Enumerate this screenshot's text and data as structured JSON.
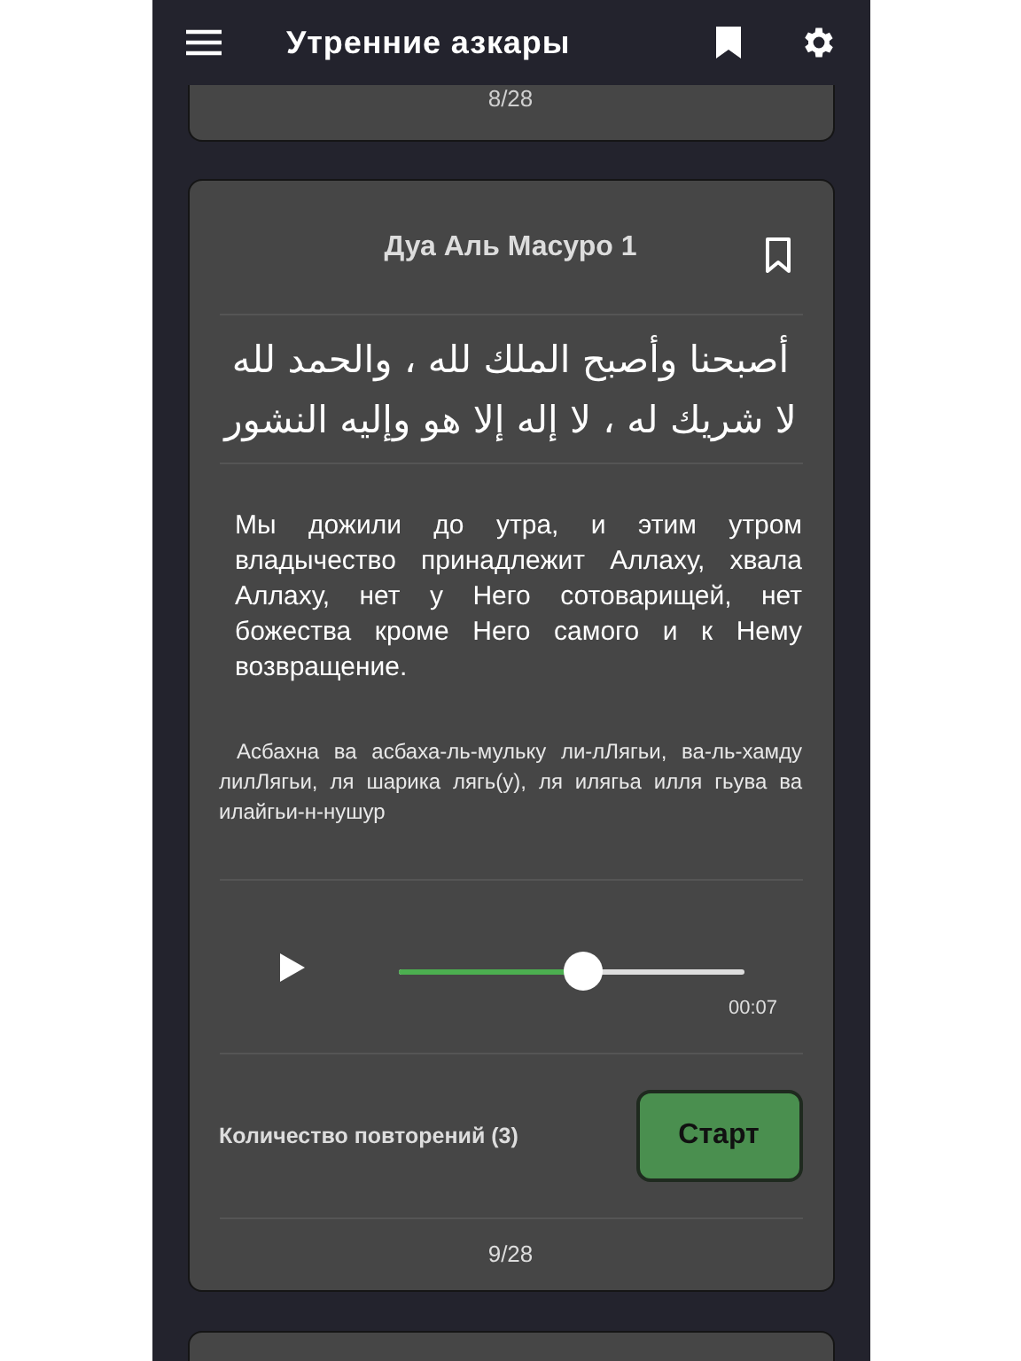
{
  "header": {
    "title": "Утренние азкары"
  },
  "previous_card": {
    "counter": "8/28"
  },
  "card": {
    "title": "Дуа Аль Масуро 1",
    "bookmarked": false,
    "arabic": "أصبحنا وأصبح الملك لله ، والحمد لله لا شريك له ، لا إله إلا هو وإليه النشور",
    "translation": "Мы дожили до утра, и этим утром владычество принадлежит Аллаху, хвала Аллаху, нет у Него сотоварищей, нет божества кроме Него самого и к Нему возвращение.",
    "transliteration": "Асбахна ва асбаха-ль-мульку ли-лЛягьи, ва-ль-хамду лилЛягьи, ля шарика лягь(у), ля илягьа илля гьува ва илайгьи-н-нушур",
    "player": {
      "playing": false,
      "level": 0.535,
      "time": "00:07"
    },
    "repeat_label": "Количество повторений (3)",
    "start_button": "Старт",
    "counter": "9/28"
  }
}
